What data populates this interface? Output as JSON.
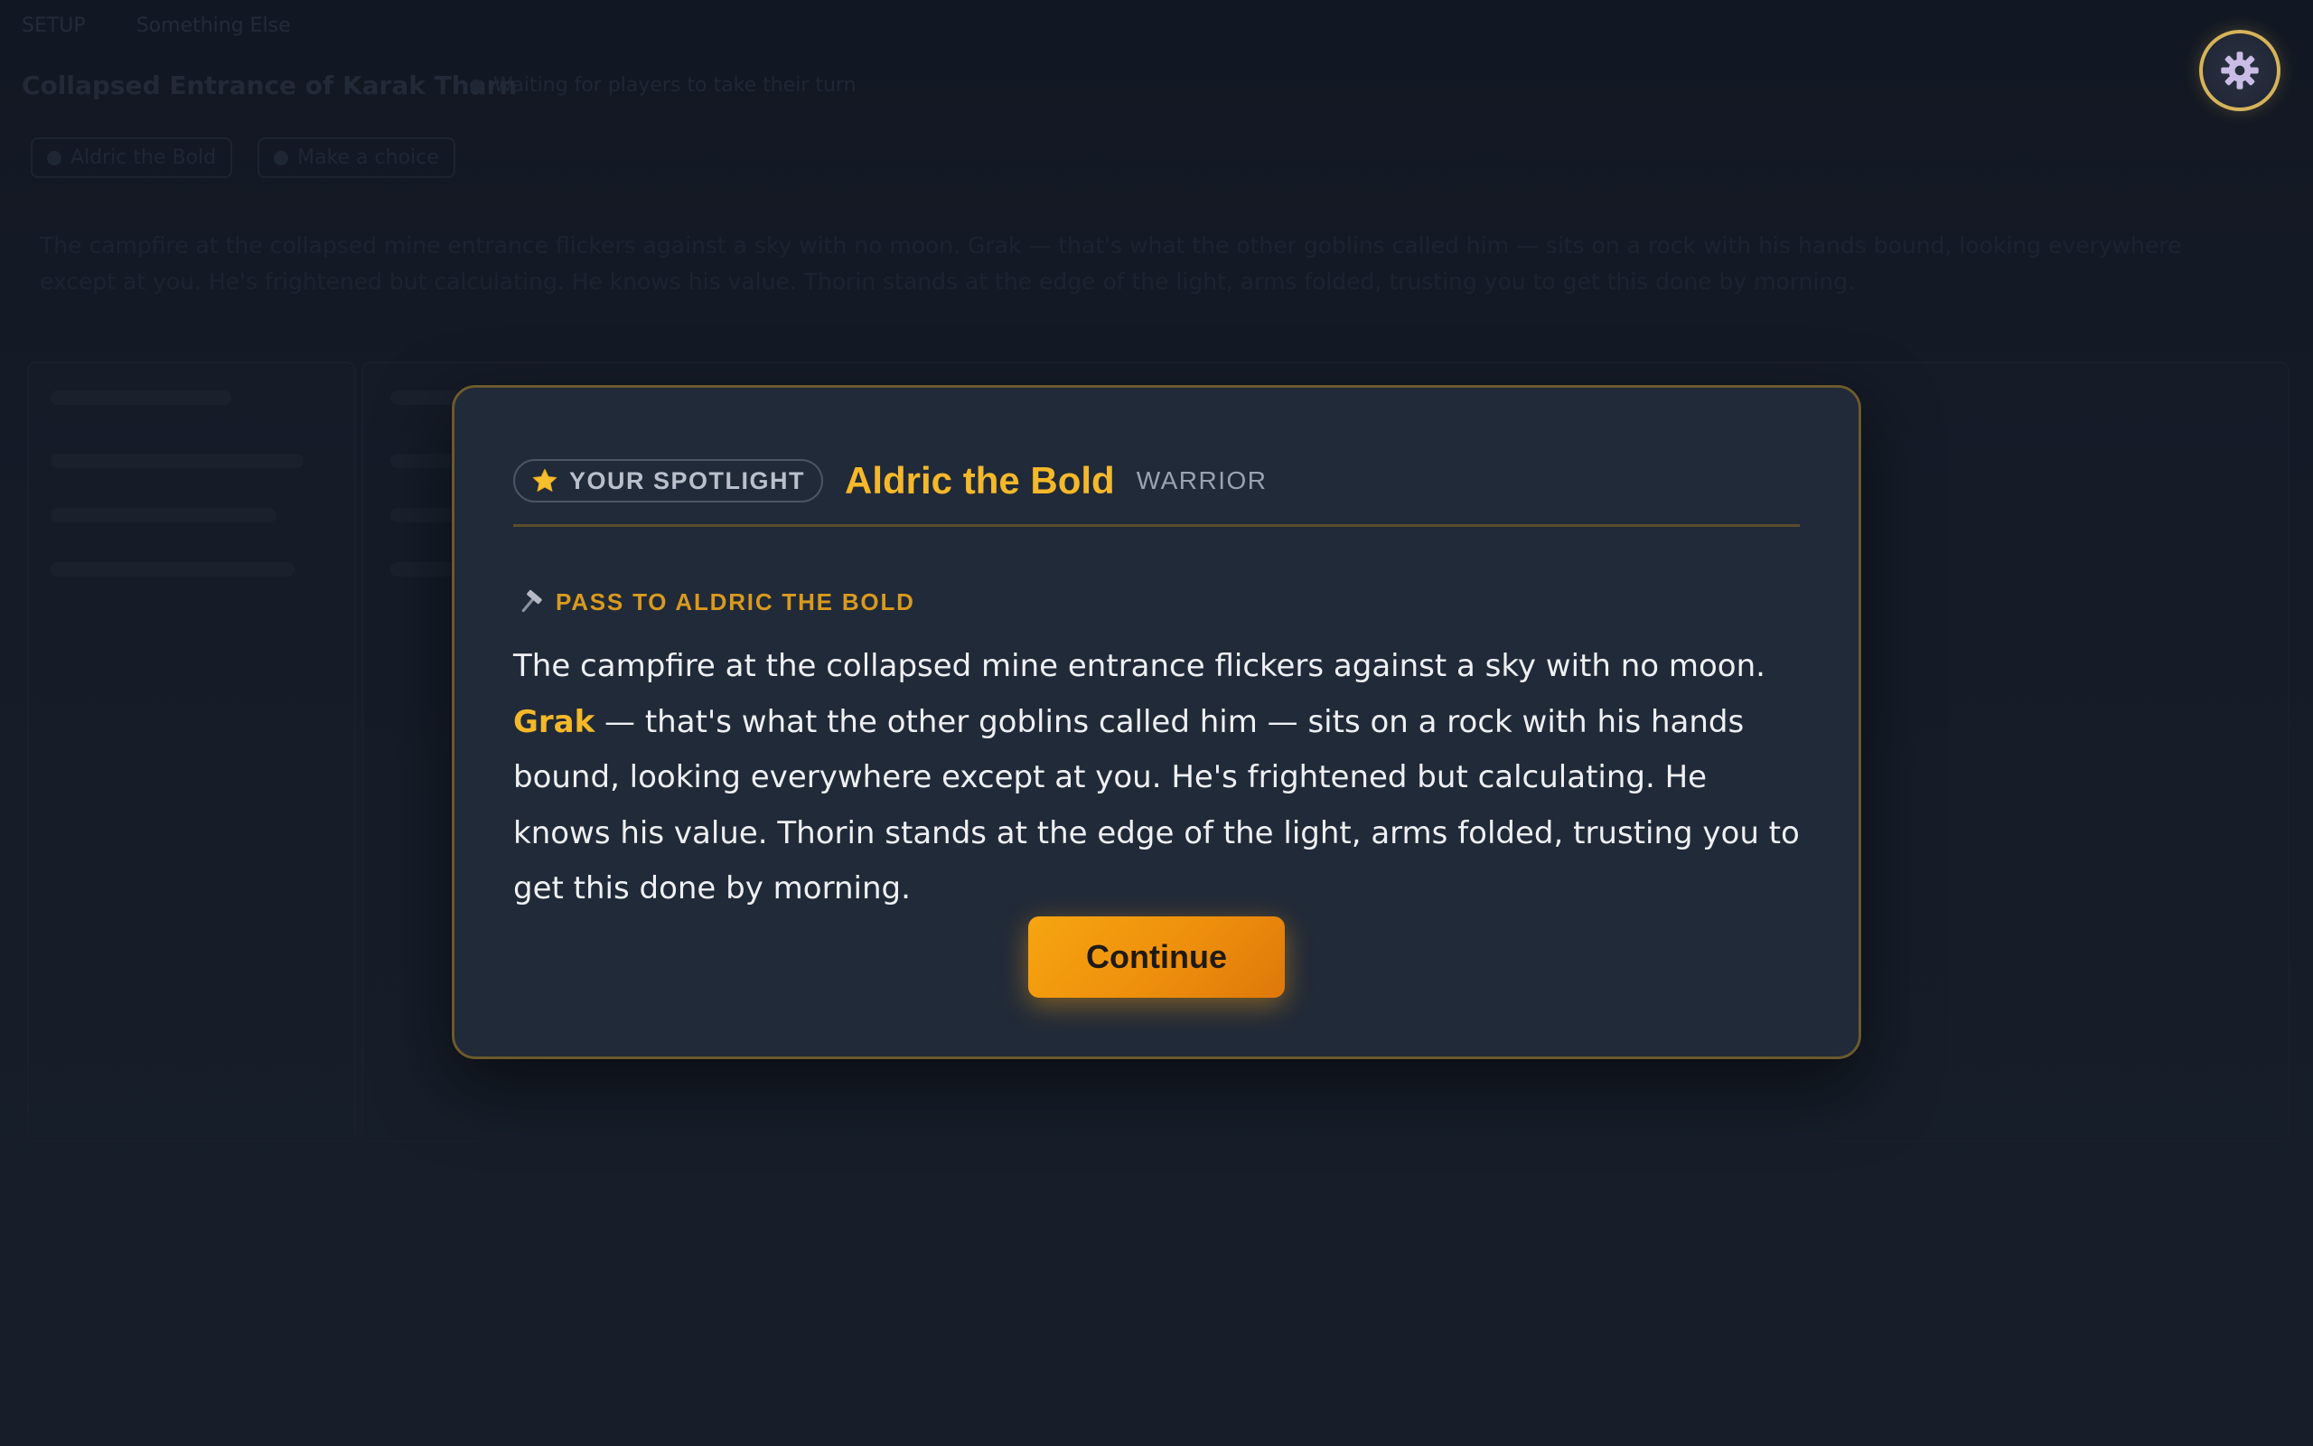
{
  "background": {
    "topbar": [
      "SETUP",
      "Something Else"
    ],
    "scene_title": "Collapsed Entrance of Karak Tharn",
    "status": "Waiting for players to take their turn",
    "chips": [
      "Aldric the Bold",
      "Make a choice"
    ],
    "narration": "The campfire at the collapsed mine entrance flickers against a sky with no moon. Grak — that's what the other goblins called him — sits on a rock with his hands bound, looking everywhere except at you. He's frightened but calculating. He knows his value. Thorin stands at the edge of the light, arms folded, trusting you to get this done by morning."
  },
  "settings": {
    "icon": "gear-icon"
  },
  "modal": {
    "badge_label": "YOUR SPOTLIGHT",
    "badge_icon": "star-icon",
    "character_name": "Aldric the Bold",
    "character_class": "WARRIOR",
    "pass_icon": "hammer-icon",
    "pass_label": "PASS TO ALDRIC THE BOLD",
    "story_before": "The campfire at the collapsed mine entrance flickers against a sky with no moon. ",
    "story_highlight": "Grak",
    "story_after": " — that's what the other goblins called him — sits on a rock with his hands bound, looking everywhere except at you. He's frightened but calculating. He knows his value. Thorin stands at the edge of the light, arms folded, trusting you to get this done by morning.",
    "continue_label": "Continue"
  },
  "colors": {
    "accent_gold": "#f5b82a",
    "button_orange": "#f6a511",
    "modal_bg": "#212a38",
    "page_bg": "#1a2230"
  }
}
